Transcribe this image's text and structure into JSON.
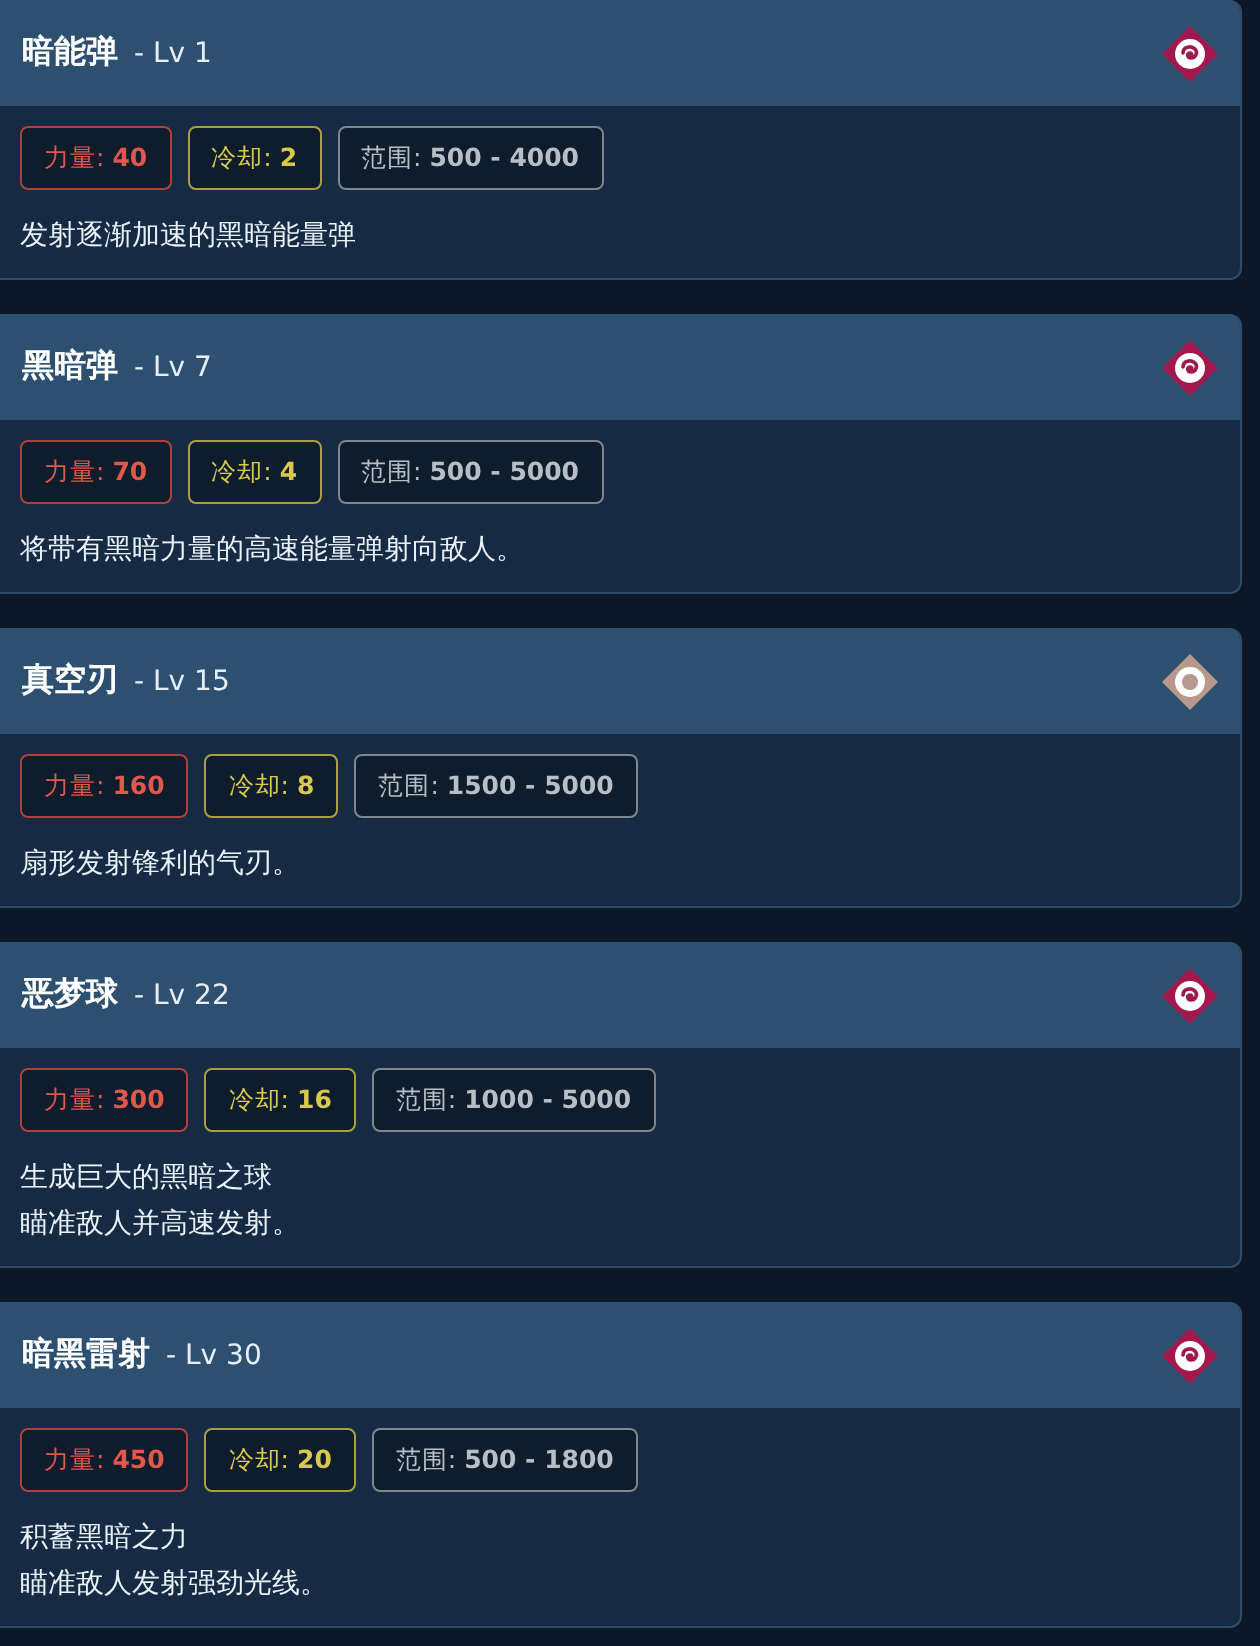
{
  "skills": [
    {
      "name": "暗能弹",
      "level_label": "- Lv 1",
      "icon": {
        "kind": "swirl"
      },
      "stats": [
        {
          "kind": "power",
          "label": "力量:",
          "value": "40"
        },
        {
          "kind": "cooldown",
          "label": "冷却:",
          "value": "2"
        },
        {
          "kind": "range",
          "label": "范围:",
          "value": "500 - 4000"
        }
      ],
      "description": [
        "发射逐渐加速的黑暗能量弹"
      ]
    },
    {
      "name": "黑暗弹",
      "level_label": "- Lv 7",
      "icon": {
        "kind": "swirl"
      },
      "stats": [
        {
          "kind": "power",
          "label": "力量:",
          "value": "70"
        },
        {
          "kind": "cooldown",
          "label": "冷却:",
          "value": "4"
        },
        {
          "kind": "range",
          "label": "范围:",
          "value": "500 - 5000"
        }
      ],
      "description": [
        "将带有黑暗力量的高速能量弹射向敌人。"
      ]
    },
    {
      "name": "真空刃",
      "level_label": "- Lv 15",
      "icon": {
        "kind": "target"
      },
      "stats": [
        {
          "kind": "power",
          "label": "力量:",
          "value": "160"
        },
        {
          "kind": "cooldown",
          "label": "冷却:",
          "value": "8"
        },
        {
          "kind": "range",
          "label": "范围:",
          "value": "1500 - 5000"
        }
      ],
      "description": [
        "扇形发射锋利的气刃。"
      ]
    },
    {
      "name": "恶梦球",
      "level_label": "- Lv 22",
      "icon": {
        "kind": "swirl"
      },
      "stats": [
        {
          "kind": "power",
          "label": "力量:",
          "value": "300"
        },
        {
          "kind": "cooldown",
          "label": "冷却:",
          "value": "16"
        },
        {
          "kind": "range",
          "label": "范围:",
          "value": "1000 - 5000"
        }
      ],
      "description": [
        "生成巨大的黑暗之球",
        "瞄准敌人并高速发射。"
      ]
    },
    {
      "name": "暗黑雷射",
      "level_label": "- Lv 30",
      "icon": {
        "kind": "swirl"
      },
      "stats": [
        {
          "kind": "power",
          "label": "力量:",
          "value": "450"
        },
        {
          "kind": "cooldown",
          "label": "冷却:",
          "value": "20"
        },
        {
          "kind": "range",
          "label": "范围:",
          "value": "500 - 1800"
        }
      ],
      "description": [
        "积蓄黑暗之力",
        "瞄准敌人发射强劲光线。"
      ]
    }
  ]
}
